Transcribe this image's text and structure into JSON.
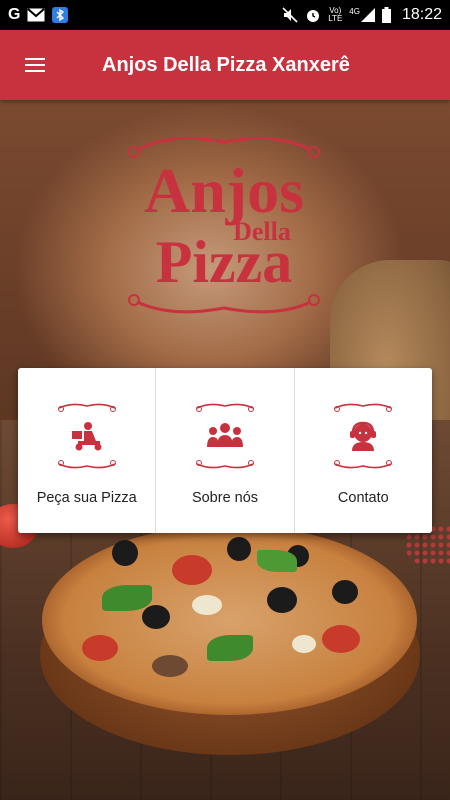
{
  "status_bar": {
    "time": "18:22",
    "network_top": "Vo)",
    "network_bottom": "LTE",
    "signal_label": "4G",
    "left_icons": [
      "google-icon",
      "gmail-icon",
      "bluetooth-app-icon"
    ],
    "right_icons": [
      "mute-icon",
      "alarm-icon",
      "volte-icon",
      "signal-icon",
      "battery-icon"
    ]
  },
  "app_bar": {
    "title": "Anjos Della Pizza Xanxerê",
    "menu_icon": "hamburger-menu-icon"
  },
  "logo": {
    "line1": "Anjos",
    "line2": "Della",
    "line3": "Pizza"
  },
  "menu": [
    {
      "label": "Peça sua Pizza",
      "icon": "delivery-scooter-icon"
    },
    {
      "label": "Sobre nós",
      "icon": "team-icon"
    },
    {
      "label": "Contato",
      "icon": "headset-operator-icon"
    }
  ],
  "colors": {
    "primary": "#c8323f",
    "card": "#ffffff",
    "text": "#222222"
  }
}
